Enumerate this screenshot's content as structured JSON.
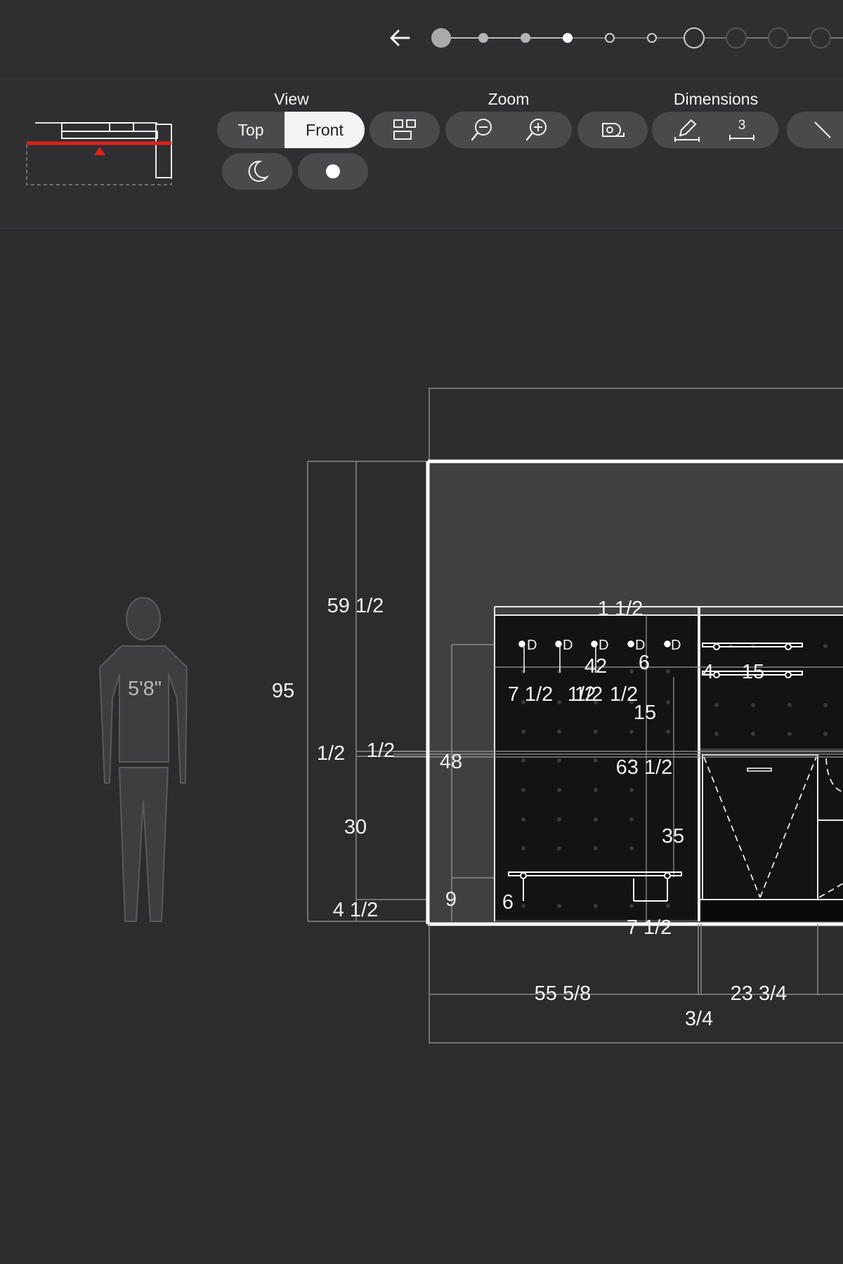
{
  "view": {
    "label": "View",
    "options": [
      "Top",
      "Front"
    ],
    "selected": "Front"
  },
  "zoom": {
    "label": "Zoom"
  },
  "dimensions": {
    "label": "Dimensions",
    "tool_value": "3"
  },
  "steps": {
    "total": 10,
    "current": 4
  },
  "figure": {
    "height_label": "5'8\""
  },
  "dims": {
    "total_height": "95",
    "upper_height": "59 1/2",
    "gap_a": "1/2",
    "gap_b": "1/2",
    "counter_height": "30",
    "toe_kick": "4 1/2",
    "top_gap": "1 1/2",
    "span_42": "42",
    "spacing_a": "7 1/2",
    "spacing_b": "1/2",
    "spacing_c": "1/2",
    "spacing_d": "1/2",
    "val_6a": "6",
    "val_15a": "15",
    "val_4": "4",
    "val_15b": "15",
    "val_48": "48",
    "val_63": "63 1/2",
    "val_35": "35",
    "val_9": "9",
    "val_6b": "6",
    "val_7": "7 1/2",
    "width_left": "55 5/8",
    "width_right": "23 3/4",
    "width_gap": "3/4"
  },
  "markers": [
    "D",
    "D",
    "D",
    "D",
    "D"
  ]
}
